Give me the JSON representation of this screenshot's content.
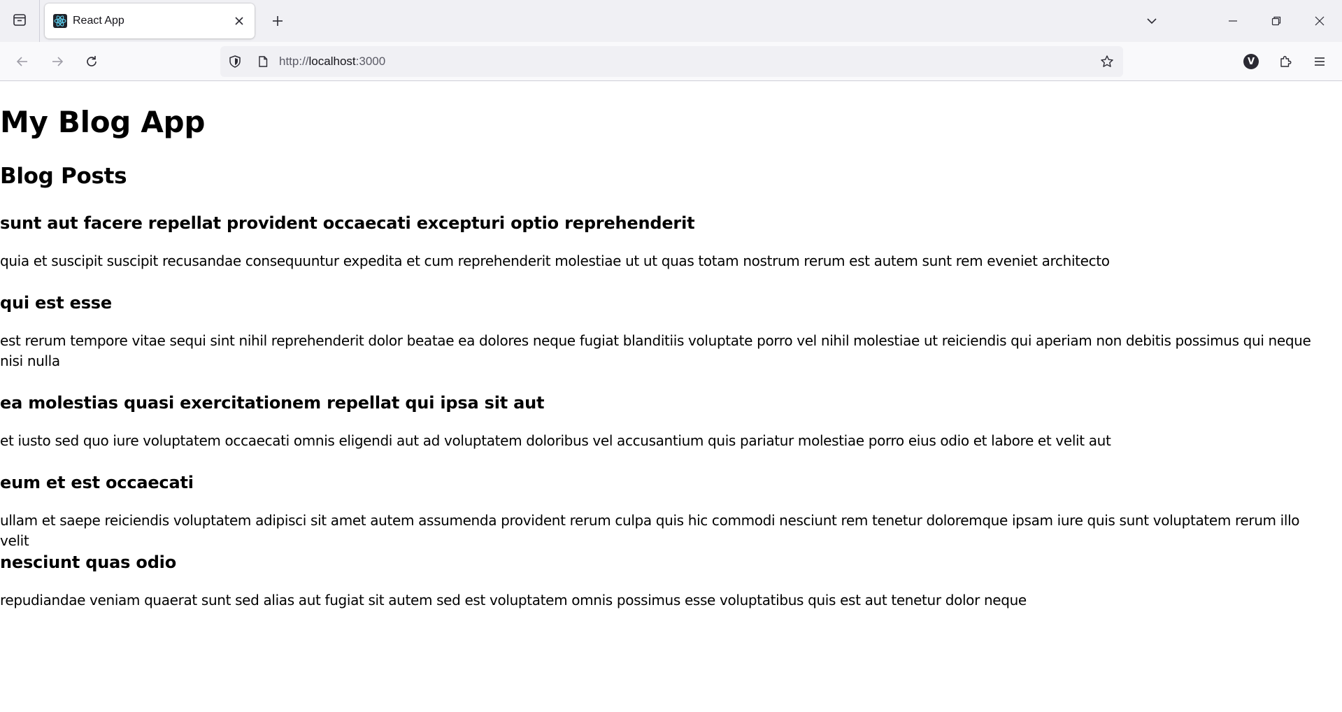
{
  "browser": {
    "tab": {
      "title": "React App"
    },
    "url": {
      "scheme": "http://",
      "host": "localhost",
      "port": ":3000"
    },
    "account_initial": "V"
  },
  "page": {
    "title": "My Blog App",
    "section_title": "Blog Posts",
    "posts": [
      {
        "title": "sunt aut facere repellat provident occaecati excepturi optio reprehenderit",
        "body": "quia et suscipit suscipit recusandae consequuntur expedita et cum reprehenderit molestiae ut ut quas totam nostrum rerum est autem sunt rem eveniet architecto"
      },
      {
        "title": "qui est esse",
        "body": "est rerum tempore vitae sequi sint nihil reprehenderit dolor beatae ea dolores neque fugiat blanditiis voluptate porro vel nihil molestiae ut reiciendis qui aperiam non debitis possimus qui neque nisi nulla"
      },
      {
        "title": "ea molestias quasi exercitationem repellat qui ipsa sit aut",
        "body": "et iusto sed quo iure voluptatem occaecati omnis eligendi aut ad voluptatem doloribus vel accusantium quis pariatur molestiae porro eius odio et labore et velit aut"
      },
      {
        "title": "eum et est occaecati",
        "body": "ullam et saepe reiciendis voluptatem adipisci sit amet autem assumenda provident rerum culpa quis hic commodi nesciunt rem tenetur doloremque ipsam iure quis sunt voluptatem rerum illo velit"
      },
      {
        "title": "nesciunt quas odio",
        "body": "repudiandae veniam quaerat sunt sed alias aut fugiat sit autem sed est voluptatem omnis possimus esse voluptatibus quis est aut tenetur dolor neque"
      }
    ]
  }
}
